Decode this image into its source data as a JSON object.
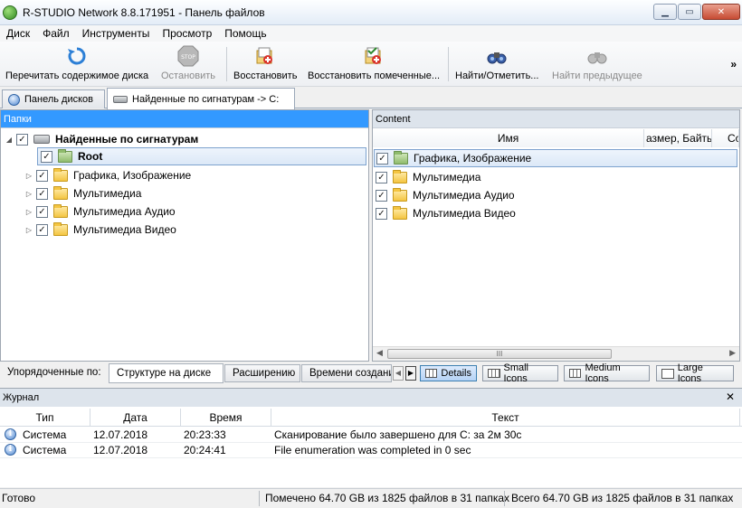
{
  "window": {
    "title": "R-STUDIO Network 8.8.171951 - Панель файлов"
  },
  "menu": [
    "Диск",
    "Файл",
    "Инструменты",
    "Просмотр",
    "Помощь"
  ],
  "toolbar": {
    "rescan": "Перечитать содержимое диска",
    "stop": "Остановить",
    "recover": "Восстановить",
    "recover_marked": "Восстановить помеченные...",
    "find_mark": "Найти/Отметить...",
    "find_prev": "Найти предыдущее",
    "more": "»"
  },
  "tabs": {
    "disks": "Панель дисков",
    "found": "Найденные по сигнатурам -> C:"
  },
  "folders_pane": {
    "header": "Папки",
    "root": "Найденные по сигнатурам",
    "root_folder": "Root",
    "children": [
      "Графика, Изображение",
      "Мультимедиа",
      "Мультимедиа Аудио",
      "Мультимедиа Видео"
    ]
  },
  "content_pane": {
    "header": "Content",
    "columns": [
      "Имя",
      "азмер, Байты",
      "Со"
    ],
    "items": [
      "Графика, Изображение",
      "Мультимедиа",
      "Мультимедиа Аудио",
      "Мультимедиа Видео"
    ],
    "hscroll_thumb": "III"
  },
  "sort": {
    "label": "Упорядоченные по:",
    "options": [
      "Структуре на диске",
      "Расширению",
      "Времени создани"
    ]
  },
  "views": [
    "Details",
    "Small Icons",
    "Medium Icons",
    "Large Icons"
  ],
  "journal": {
    "header": "Журнал",
    "columns": [
      "Тип",
      "Дата",
      "Время",
      "Текст"
    ],
    "rows": [
      {
        "type": "Система",
        "date": "12.07.2018",
        "time": "20:23:33",
        "text": "Сканирование было завершено для C: за 2м 30с"
      },
      {
        "type": "Система",
        "date": "12.07.2018",
        "time": "20:24:41",
        "text": "File enumeration was completed in 0 sec"
      }
    ]
  },
  "status": {
    "ready": "Готово",
    "marked": "Помечено 64.70 GB из 1825 файлов в 31 папках",
    "total": "Всего 64.70 GB из 1825 файлов в 31 папках"
  }
}
